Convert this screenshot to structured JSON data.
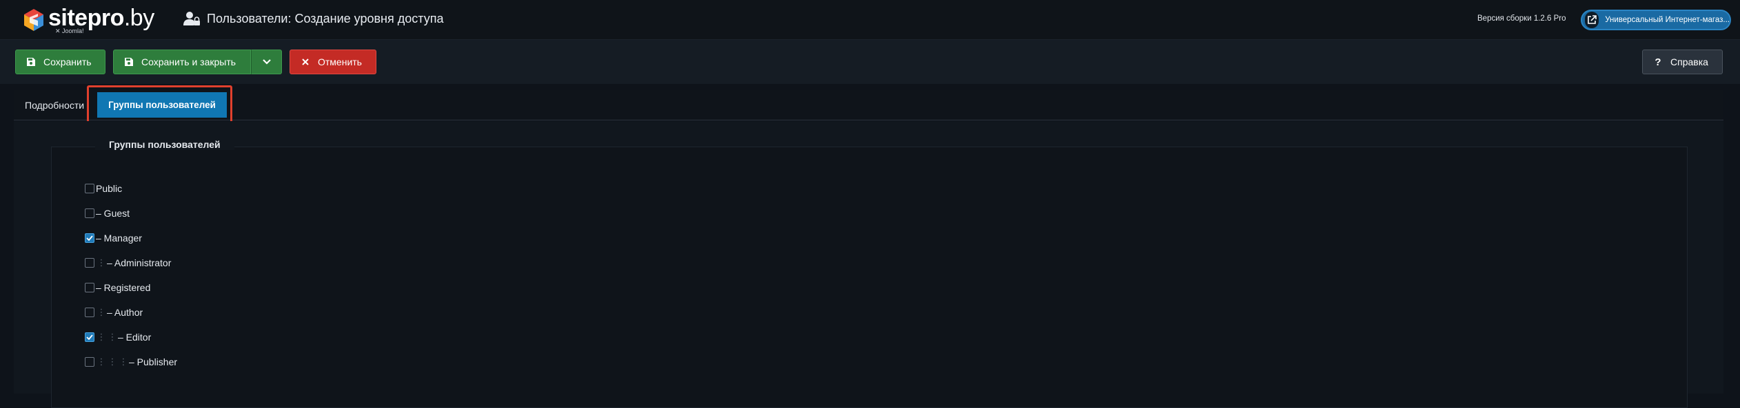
{
  "header": {
    "logo_text": "sitepro",
    "logo_suffix": ".by",
    "logo_sub": "Joomla!",
    "page_title": "Пользователи: Создание уровня доступа",
    "version": "Версия сборки 1.2.6 Pro",
    "site_link": "Универсальный Интернет-магаз..."
  },
  "toolbar": {
    "save_label": "Сохранить",
    "save_close_label": "Сохранить и закрыть",
    "cancel_label": "Отменить",
    "help_label": "Справка"
  },
  "tabs": {
    "details": "Подробности",
    "groups": "Группы пользователей"
  },
  "groups": {
    "legend": "Группы пользователей",
    "items": [
      {
        "label": "Public",
        "checked": false
      },
      {
        "label": "– Guest",
        "checked": false
      },
      {
        "label": "– Manager",
        "checked": true
      },
      {
        "label": "– Administrator",
        "checked": false
      },
      {
        "label": "– Registered",
        "checked": false
      },
      {
        "label": "– Author",
        "checked": false
      },
      {
        "label": "– Editor",
        "checked": true
      },
      {
        "label": "– Publisher",
        "checked": false
      }
    ]
  },
  "colors": {
    "accent": "#1077b3",
    "save": "#2e7d3c",
    "cancel": "#c42b25",
    "highlight": "#e0402d"
  }
}
